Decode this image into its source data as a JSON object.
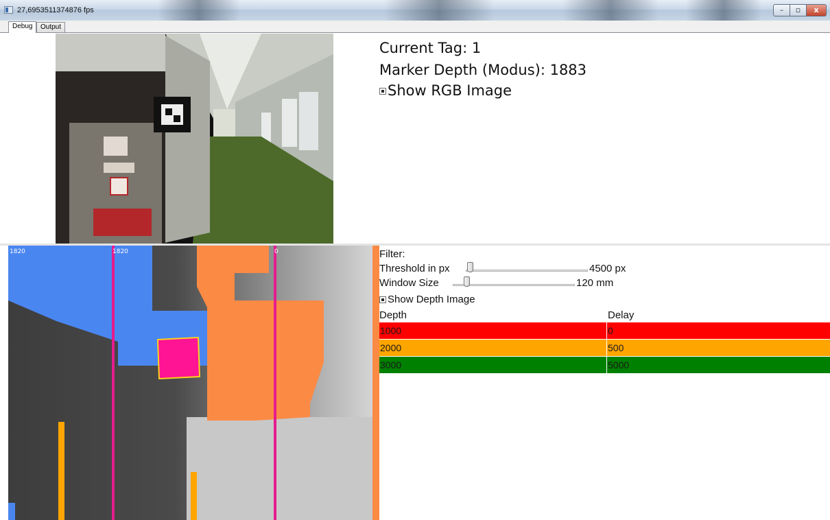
{
  "window": {
    "title": "27,6953511374876 fps",
    "minimize_glyph": "–",
    "maximize_glyph": "▫",
    "close_glyph": "x"
  },
  "tabs": [
    {
      "label": "Debug",
      "selected": true
    },
    {
      "label": "Output",
      "selected": false
    }
  ],
  "info": {
    "current_tag": "Current Tag:  1",
    "marker_depth": "Marker Depth (Modus):  1883",
    "show_rgb_label": "Show RGB Image",
    "show_rgb_checked": true
  },
  "filter": {
    "title": "Filter:",
    "threshold_label": "Threshold in px",
    "threshold_value": "4500 px",
    "threshold_fraction": 0.05,
    "window_label": "Window Size",
    "window_value": "120 mm",
    "window_fraction": 0.1,
    "show_depth_label": "Show Depth Image",
    "show_depth_checked": true
  },
  "depth_overlay": {
    "labels": [
      "1820",
      "1820",
      "0"
    ]
  },
  "table": {
    "headers": [
      "Depth",
      "Delay"
    ],
    "rows": [
      {
        "depth": "1000",
        "delay": "0",
        "color": "#ff0000"
      },
      {
        "depth": "2000",
        "delay": "500",
        "color": "#ffa500"
      },
      {
        "depth": "3000",
        "delay": "5000",
        "color": "#008000"
      }
    ]
  },
  "colors": {
    "depth_blue": "#4a86f0",
    "depth_orange": "#fb8a45",
    "marker_pink": "#ff1493",
    "column_yellow": "#ffa500",
    "line_magenta": "#e61c8e"
  }
}
